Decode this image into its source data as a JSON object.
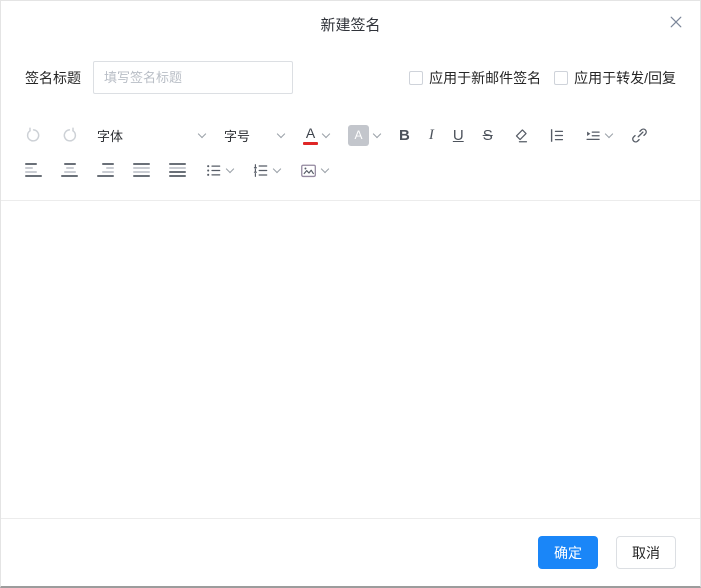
{
  "dialog": {
    "title": "新建签名"
  },
  "form": {
    "title_label": "签名标题",
    "title_placeholder": "填写签名标题",
    "title_value": "",
    "apply_new_mail_label": "应用于新邮件签名",
    "apply_new_mail_checked": false,
    "apply_forward_reply_label": "应用于转发/回复",
    "apply_forward_reply_checked": false
  },
  "toolbar": {
    "font_family_label": "字体",
    "font_size_label": "字号",
    "font_color_letter": "A",
    "highlight_letter": "A",
    "bold_label": "B",
    "italic_label": "I",
    "underline_label": "U",
    "strikethrough_label": "S",
    "row1_icons": [
      "undo-icon",
      "redo-icon",
      "font-family-dropdown",
      "font-size-dropdown",
      "font-color-picker",
      "highlight-color-picker",
      "bold-button",
      "italic-button",
      "underline-button",
      "strikethrough-button",
      "clear-format-icon",
      "line-spacing-icon",
      "indent-icon",
      "insert-link-icon"
    ],
    "row2_icons": [
      "align-left-icon",
      "align-center-icon",
      "align-right-icon",
      "align-justify-icon",
      "align-distribute-icon",
      "bullet-list-icon",
      "ordered-list-icon",
      "insert-image-icon"
    ]
  },
  "editor": {
    "content": ""
  },
  "footer": {
    "confirm_label": "确定",
    "cancel_label": "取消"
  },
  "colors": {
    "primary_blue": "#1a86f8",
    "font_color_red": "#df2626",
    "highlight_gray": "#c3c6cc",
    "icon_gray": "#565c66",
    "disabled_icon_gray": "#cdd1d6"
  }
}
